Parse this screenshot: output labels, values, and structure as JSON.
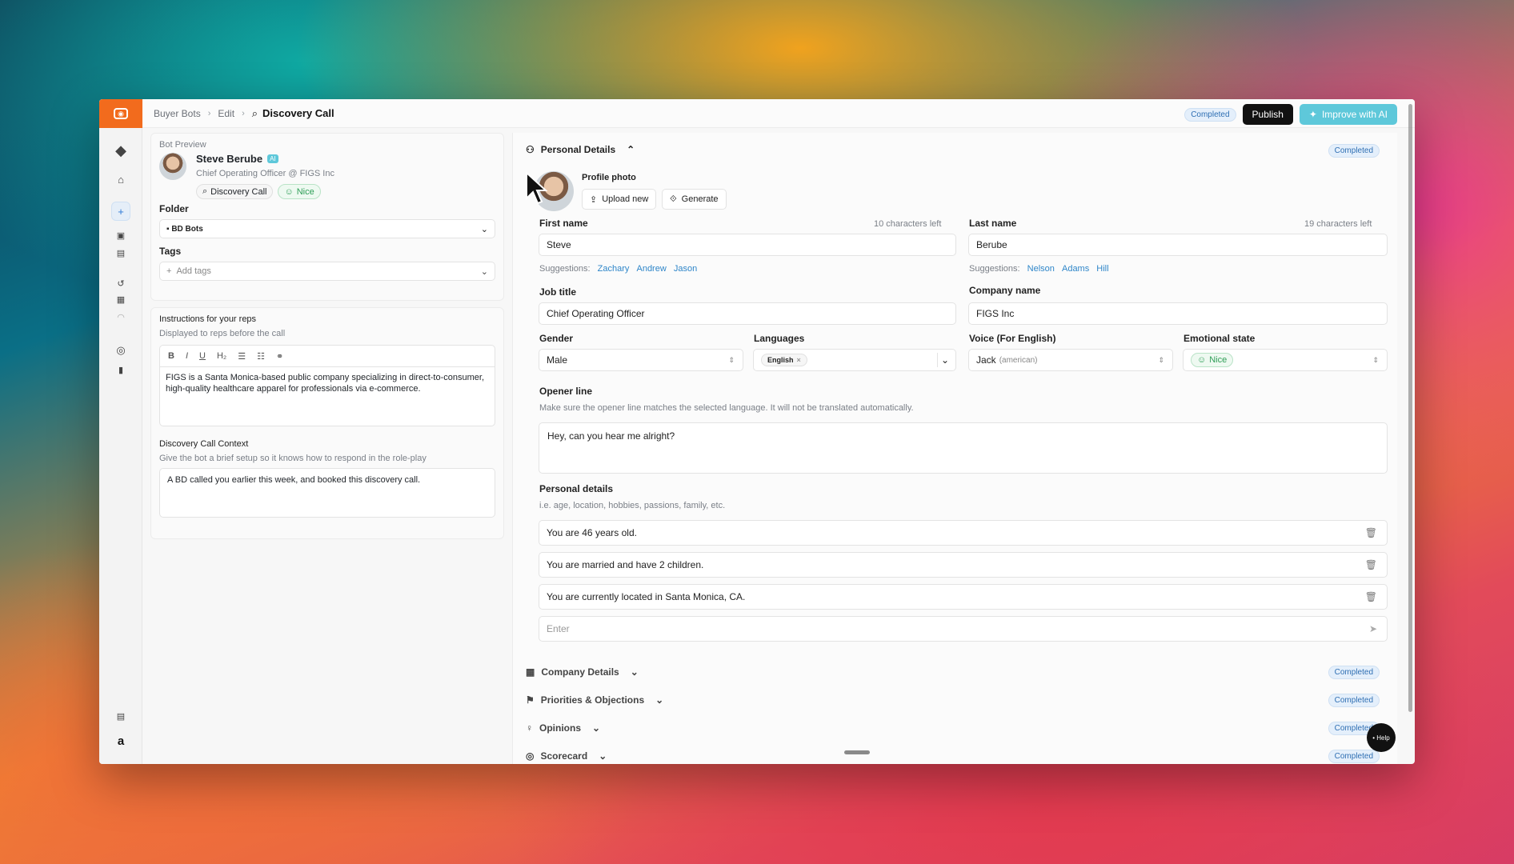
{
  "breadcrumb": {
    "root": "Buyer Bots",
    "edit": "Edit",
    "current": "Discovery Call"
  },
  "header": {
    "status": "Completed",
    "publish": "Publish",
    "improve": "Improve with AI"
  },
  "bot_preview": {
    "title": "Bot Preview",
    "name": "Steve Berube",
    "ai_badge": "AI",
    "role": "Chief Operating Officer @ FIGS Inc",
    "call_type": "Discovery Call",
    "mood": "Nice"
  },
  "folder": {
    "label": "Folder",
    "value": "BD Bots"
  },
  "tags": {
    "label": "Tags",
    "placeholder": "Add tags"
  },
  "instructions": {
    "label": "Instructions for your reps",
    "hint": "Displayed to reps before the call",
    "text": "FIGS is a Santa Monica-based public company specializing in direct-to-consumer, high-quality healthcare apparel for professionals via e-commerce."
  },
  "call_context": {
    "label": "Discovery Call Context",
    "hint": "Give the bot a brief setup so it knows how to respond in the role-play",
    "text": "A BD called you earlier this week, and booked this discovery call."
  },
  "personal": {
    "section": "Personal Details",
    "status": "Completed",
    "photo_label": "Profile photo",
    "upload": "Upload new",
    "generate": "Generate",
    "first_name_label": "First name",
    "first_name_left": "10 characters left",
    "first_name": "Steve",
    "first_suggest_label": "Suggestions:",
    "first_suggestions": [
      "Zachary",
      "Andrew",
      "Jason"
    ],
    "last_name_label": "Last name",
    "last_name_left": "19 characters left",
    "last_name": "Berube",
    "last_suggest_label": "Suggestions:",
    "last_suggestions": [
      "Nelson",
      "Adams",
      "Hill"
    ],
    "job_label": "Job title",
    "job": "Chief Operating Officer",
    "company_label": "Company name",
    "company": "FIGS Inc",
    "gender_label": "Gender",
    "gender": "Male",
    "languages_label": "Languages",
    "language": "English",
    "voice_label": "Voice (For English)",
    "voice": "Jack",
    "voice_note": "(american)",
    "emotion_label": "Emotional state",
    "emotion": "Nice",
    "opener_label": "Opener line",
    "opener_hint": "Make sure the opener line matches the selected language. It will not be translated automatically.",
    "opener": "Hey, can you hear me alright?",
    "details_label": "Personal details",
    "details_hint": "i.e. age, location, hobbies, passions, family, etc.",
    "details": [
      "You are 46 years old.",
      "You are married and have 2 children.",
      "You are currently located in Santa Monica, CA."
    ],
    "enter_placeholder": "Enter"
  },
  "sections": [
    {
      "label": "Company Details",
      "status": "Completed"
    },
    {
      "label": "Priorities & Objections",
      "status": "Completed"
    },
    {
      "label": "Opinions",
      "status": "Completed"
    },
    {
      "label": "Scorecard",
      "status": "Completed"
    }
  ],
  "help": "• Help"
}
